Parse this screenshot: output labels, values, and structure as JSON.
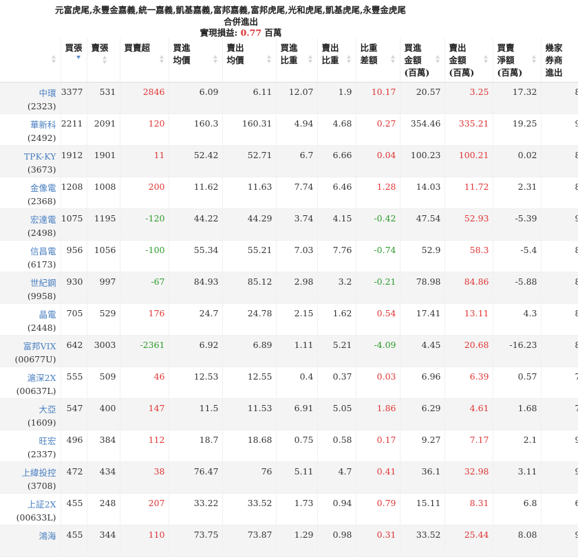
{
  "header": {
    "brokers": "元富虎尾,永豐金嘉義,統一嘉義,凱基嘉義,富邦嘉義,富邦虎尾,光和虎尾,凱基虎尾,永豐金虎尾",
    "subtitle": "合併進出",
    "pnl_label": "實現損益:",
    "pnl_value": "0.77",
    "pnl_unit": "百萬"
  },
  "columns": [
    "",
    "買張",
    "賣張",
    "買賣超",
    "買進\n均價",
    "賣出\n均價",
    "買進\n比重",
    "賣出\n比重",
    "比重\n差額",
    "買進\n金額\n(百萬)",
    "賣出\n金額\n(百萬)",
    "買賣\n淨額\n(百萬)",
    "幾家\n券商\n進出"
  ],
  "rows": [
    {
      "name": "中環",
      "code": "(2323)",
      "buy": "3377",
      "sell": "531",
      "net": "2846",
      "bavg": "6.09",
      "savg": "6.11",
      "bw": "12.07",
      "sw": "1.9",
      "diff": "10.17",
      "bamt": "20.57",
      "samt": "3.25",
      "namt": "17.32",
      "cnt": "8"
    },
    {
      "name": "華新科",
      "code": "(2492)",
      "buy": "2211",
      "sell": "2091",
      "net": "120",
      "bavg": "160.3",
      "savg": "160.31",
      "bw": "4.94",
      "sw": "4.68",
      "diff": "0.27",
      "bamt": "354.46",
      "samt": "335.21",
      "namt": "19.25",
      "cnt": "9"
    },
    {
      "name": "TPK-KY",
      "code": "(3673)",
      "buy": "1912",
      "sell": "1901",
      "net": "11",
      "bavg": "52.42",
      "savg": "52.71",
      "bw": "6.7",
      "sw": "6.66",
      "diff": "0.04",
      "bamt": "100.23",
      "samt": "100.21",
      "namt": "0.02",
      "cnt": "8"
    },
    {
      "name": "金像電",
      "code": "(2368)",
      "buy": "1208",
      "sell": "1008",
      "net": "200",
      "bavg": "11.62",
      "savg": "11.63",
      "bw": "7.74",
      "sw": "6.46",
      "diff": "1.28",
      "bamt": "14.03",
      "samt": "11.72",
      "namt": "2.31",
      "cnt": "8"
    },
    {
      "name": "宏達電",
      "code": "(2498)",
      "buy": "1075",
      "sell": "1195",
      "net": "-120",
      "bavg": "44.22",
      "savg": "44.29",
      "bw": "3.74",
      "sw": "4.15",
      "diff": "-0.42",
      "bamt": "47.54",
      "samt": "52.93",
      "namt": "-5.39",
      "cnt": "9"
    },
    {
      "name": "信昌電",
      "code": "(6173)",
      "buy": "956",
      "sell": "1056",
      "net": "-100",
      "bavg": "55.34",
      "savg": "55.21",
      "bw": "7.03",
      "sw": "7.76",
      "diff": "-0.74",
      "bamt": "52.9",
      "samt": "58.3",
      "namt": "-5.4",
      "cnt": "8"
    },
    {
      "name": "世紀鋼",
      "code": "(9958)",
      "buy": "930",
      "sell": "997",
      "net": "-67",
      "bavg": "84.93",
      "savg": "85.12",
      "bw": "2.98",
      "sw": "3.2",
      "diff": "-0.21",
      "bamt": "78.98",
      "samt": "84.86",
      "namt": "-5.88",
      "cnt": "8"
    },
    {
      "name": "晶電",
      "code": "(2448)",
      "buy": "705",
      "sell": "529",
      "net": "176",
      "bavg": "24.7",
      "savg": "24.78",
      "bw": "2.15",
      "sw": "1.62",
      "diff": "0.54",
      "bamt": "17.41",
      "samt": "13.11",
      "namt": "4.3",
      "cnt": "8"
    },
    {
      "name": "富邦VIX",
      "code": "(00677U)",
      "buy": "642",
      "sell": "3003",
      "net": "-2361",
      "bavg": "6.92",
      "savg": "6.89",
      "bw": "1.11",
      "sw": "5.21",
      "diff": "-4.09",
      "bamt": "4.45",
      "samt": "20.68",
      "namt": "-16.23",
      "cnt": "8"
    },
    {
      "name": "滬深2X",
      "code": "(00637L)",
      "buy": "555",
      "sell": "509",
      "net": "46",
      "bavg": "12.53",
      "savg": "12.55",
      "bw": "0.4",
      "sw": "0.37",
      "diff": "0.03",
      "bamt": "6.96",
      "samt": "6.39",
      "namt": "0.57",
      "cnt": "7"
    },
    {
      "name": "大亞",
      "code": "(1609)",
      "buy": "547",
      "sell": "400",
      "net": "147",
      "bavg": "11.5",
      "savg": "11.53",
      "bw": "6.91",
      "sw": "5.05",
      "diff": "1.86",
      "bamt": "6.29",
      "samt": "4.61",
      "namt": "1.68",
      "cnt": "7"
    },
    {
      "name": "旺宏",
      "code": "(2337)",
      "buy": "496",
      "sell": "384",
      "net": "112",
      "bavg": "18.7",
      "savg": "18.68",
      "bw": "0.75",
      "sw": "0.58",
      "diff": "0.17",
      "bamt": "9.27",
      "samt": "7.17",
      "namt": "2.1",
      "cnt": "9"
    },
    {
      "name": "上緯投控",
      "code": "(3708)",
      "buy": "472",
      "sell": "434",
      "net": "38",
      "bavg": "76.47",
      "savg": "76",
      "bw": "5.11",
      "sw": "4.7",
      "diff": "0.41",
      "bamt": "36.1",
      "samt": "32.98",
      "namt": "3.11",
      "cnt": "9"
    },
    {
      "name": "上証2X",
      "code": "(00633L)",
      "buy": "455",
      "sell": "248",
      "net": "207",
      "bavg": "33.22",
      "savg": "33.52",
      "bw": "1.73",
      "sw": "0.94",
      "diff": "0.79",
      "bamt": "15.11",
      "samt": "8.31",
      "namt": "6.8",
      "cnt": "6"
    },
    {
      "name": "鴻海",
      "code": "",
      "buy": "455",
      "sell": "344",
      "net": "110",
      "bavg": "73.75",
      "savg": "73.87",
      "bw": "1.29",
      "sw": "0.98",
      "diff": "0.31",
      "bamt": "33.52",
      "samt": "25.44",
      "namt": "8.08",
      "cnt": "9"
    }
  ]
}
